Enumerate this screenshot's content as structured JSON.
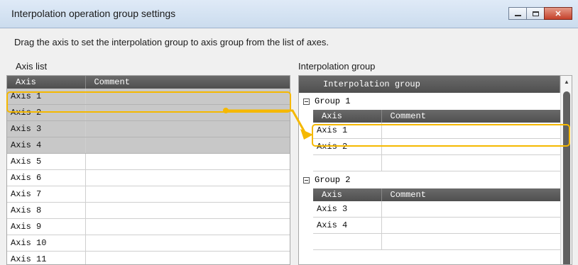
{
  "window": {
    "title": "Interpolation operation group settings",
    "controls": {
      "minimize_icon": "minimize-icon",
      "maximize_icon": "maximize-icon",
      "close_label": "✕"
    }
  },
  "instruction": "Drag the axis to set the interpolation group to axis group from the list of axes.",
  "axis_list": {
    "label": "Axis list",
    "columns": [
      "Axis",
      "Comment"
    ],
    "rows": [
      {
        "axis": "Axis 1",
        "comment": ""
      },
      {
        "axis": "Axis 2",
        "comment": ""
      },
      {
        "axis": "Axis 3",
        "comment": ""
      },
      {
        "axis": "Axis 4",
        "comment": ""
      },
      {
        "axis": "Axis 5",
        "comment": ""
      },
      {
        "axis": "Axis 6",
        "comment": ""
      },
      {
        "axis": "Axis 7",
        "comment": ""
      },
      {
        "axis": "Axis 8",
        "comment": ""
      },
      {
        "axis": "Axis 9",
        "comment": ""
      },
      {
        "axis": "Axis 10",
        "comment": ""
      },
      {
        "axis": "Axis 11",
        "comment": ""
      }
    ],
    "selected_rows": [
      0,
      1,
      2,
      3
    ]
  },
  "interpolation": {
    "label": "Interpolation group",
    "header": "Interpolation group",
    "columns": [
      "Axis",
      "Comment"
    ],
    "groups": [
      {
        "name": "Group 1",
        "rows": [
          {
            "axis": "Axis 1",
            "comment": ""
          },
          {
            "axis": "Axis 2",
            "comment": ""
          },
          {
            "axis": "",
            "comment": ""
          }
        ]
      },
      {
        "name": "Group 2",
        "rows": [
          {
            "axis": "Axis 3",
            "comment": ""
          },
          {
            "axis": "Axis 4",
            "comment": ""
          },
          {
            "axis": "",
            "comment": ""
          }
        ]
      }
    ]
  },
  "colors": {
    "highlight": "#f5b800",
    "header_dark": "#5a5a5a",
    "selected_row": "#c8c8c8",
    "close_button": "#c5412b"
  }
}
